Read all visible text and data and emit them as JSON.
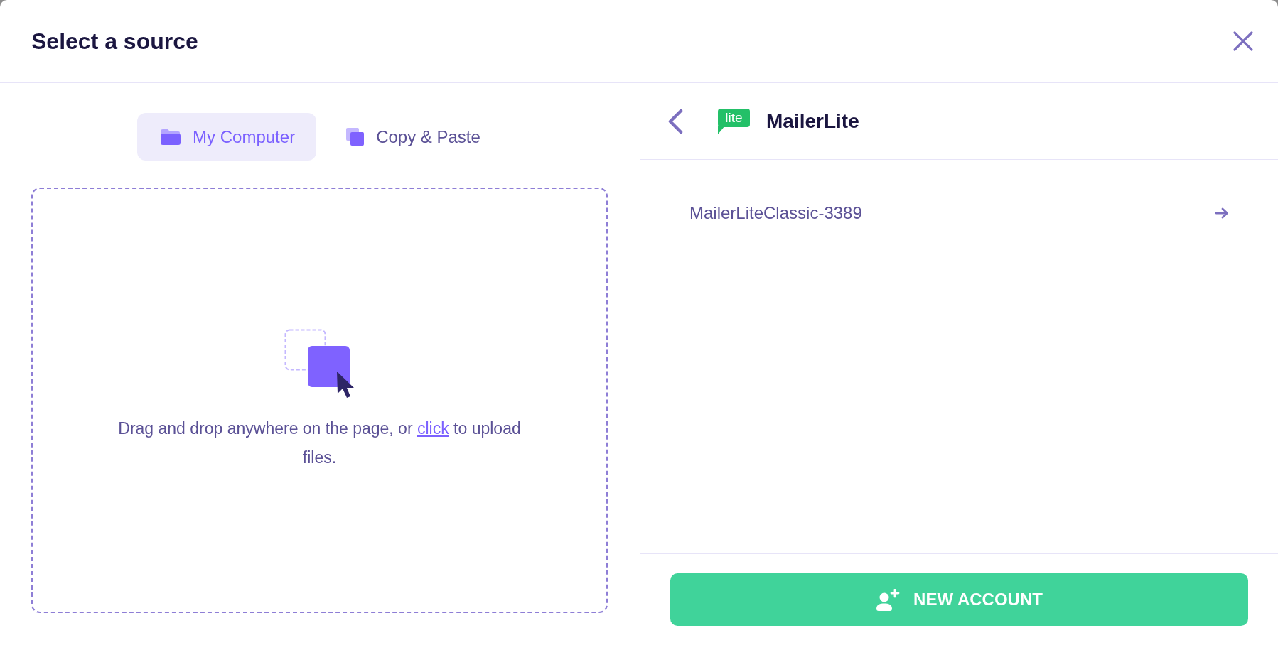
{
  "dialog": {
    "title": "Select a source"
  },
  "tabs": [
    {
      "kind": "folder",
      "label": "My Computer",
      "selected": true
    },
    {
      "kind": "copy",
      "label": "Copy & Paste",
      "selected": false
    }
  ],
  "dropzone": {
    "text_before": "Drag and drop anywhere on the page, or",
    "link": "click",
    "text_after": "to upload files."
  },
  "source": {
    "logo_text": "lite",
    "name": "MailerLite"
  },
  "accounts": [
    {
      "name": "MailerLiteClassic-3389"
    }
  ],
  "new_account_button": {
    "label": "NEW ACCOUNT"
  }
}
